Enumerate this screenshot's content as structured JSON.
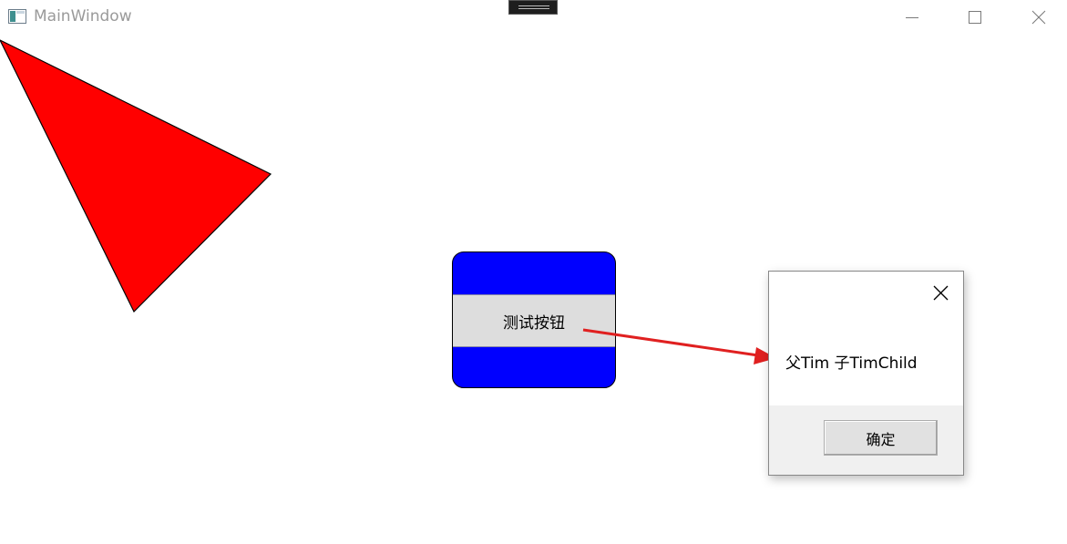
{
  "window": {
    "title": "MainWindow"
  },
  "titlebar": {
    "icons": {
      "app": "window-app-icon",
      "minimize": "minimize-icon",
      "maximize": "maximize-icon",
      "close": "close-icon"
    }
  },
  "canvas": {
    "triangle_color": "#ff0000",
    "button": {
      "label": "测试按钮",
      "outer_color": "#0000ff",
      "content_color": "#dddddd"
    },
    "arrow_color": "#e02020"
  },
  "message_box": {
    "text": "父Tim 子TimChild",
    "ok_label": "确定",
    "close_icon": "close-icon"
  }
}
